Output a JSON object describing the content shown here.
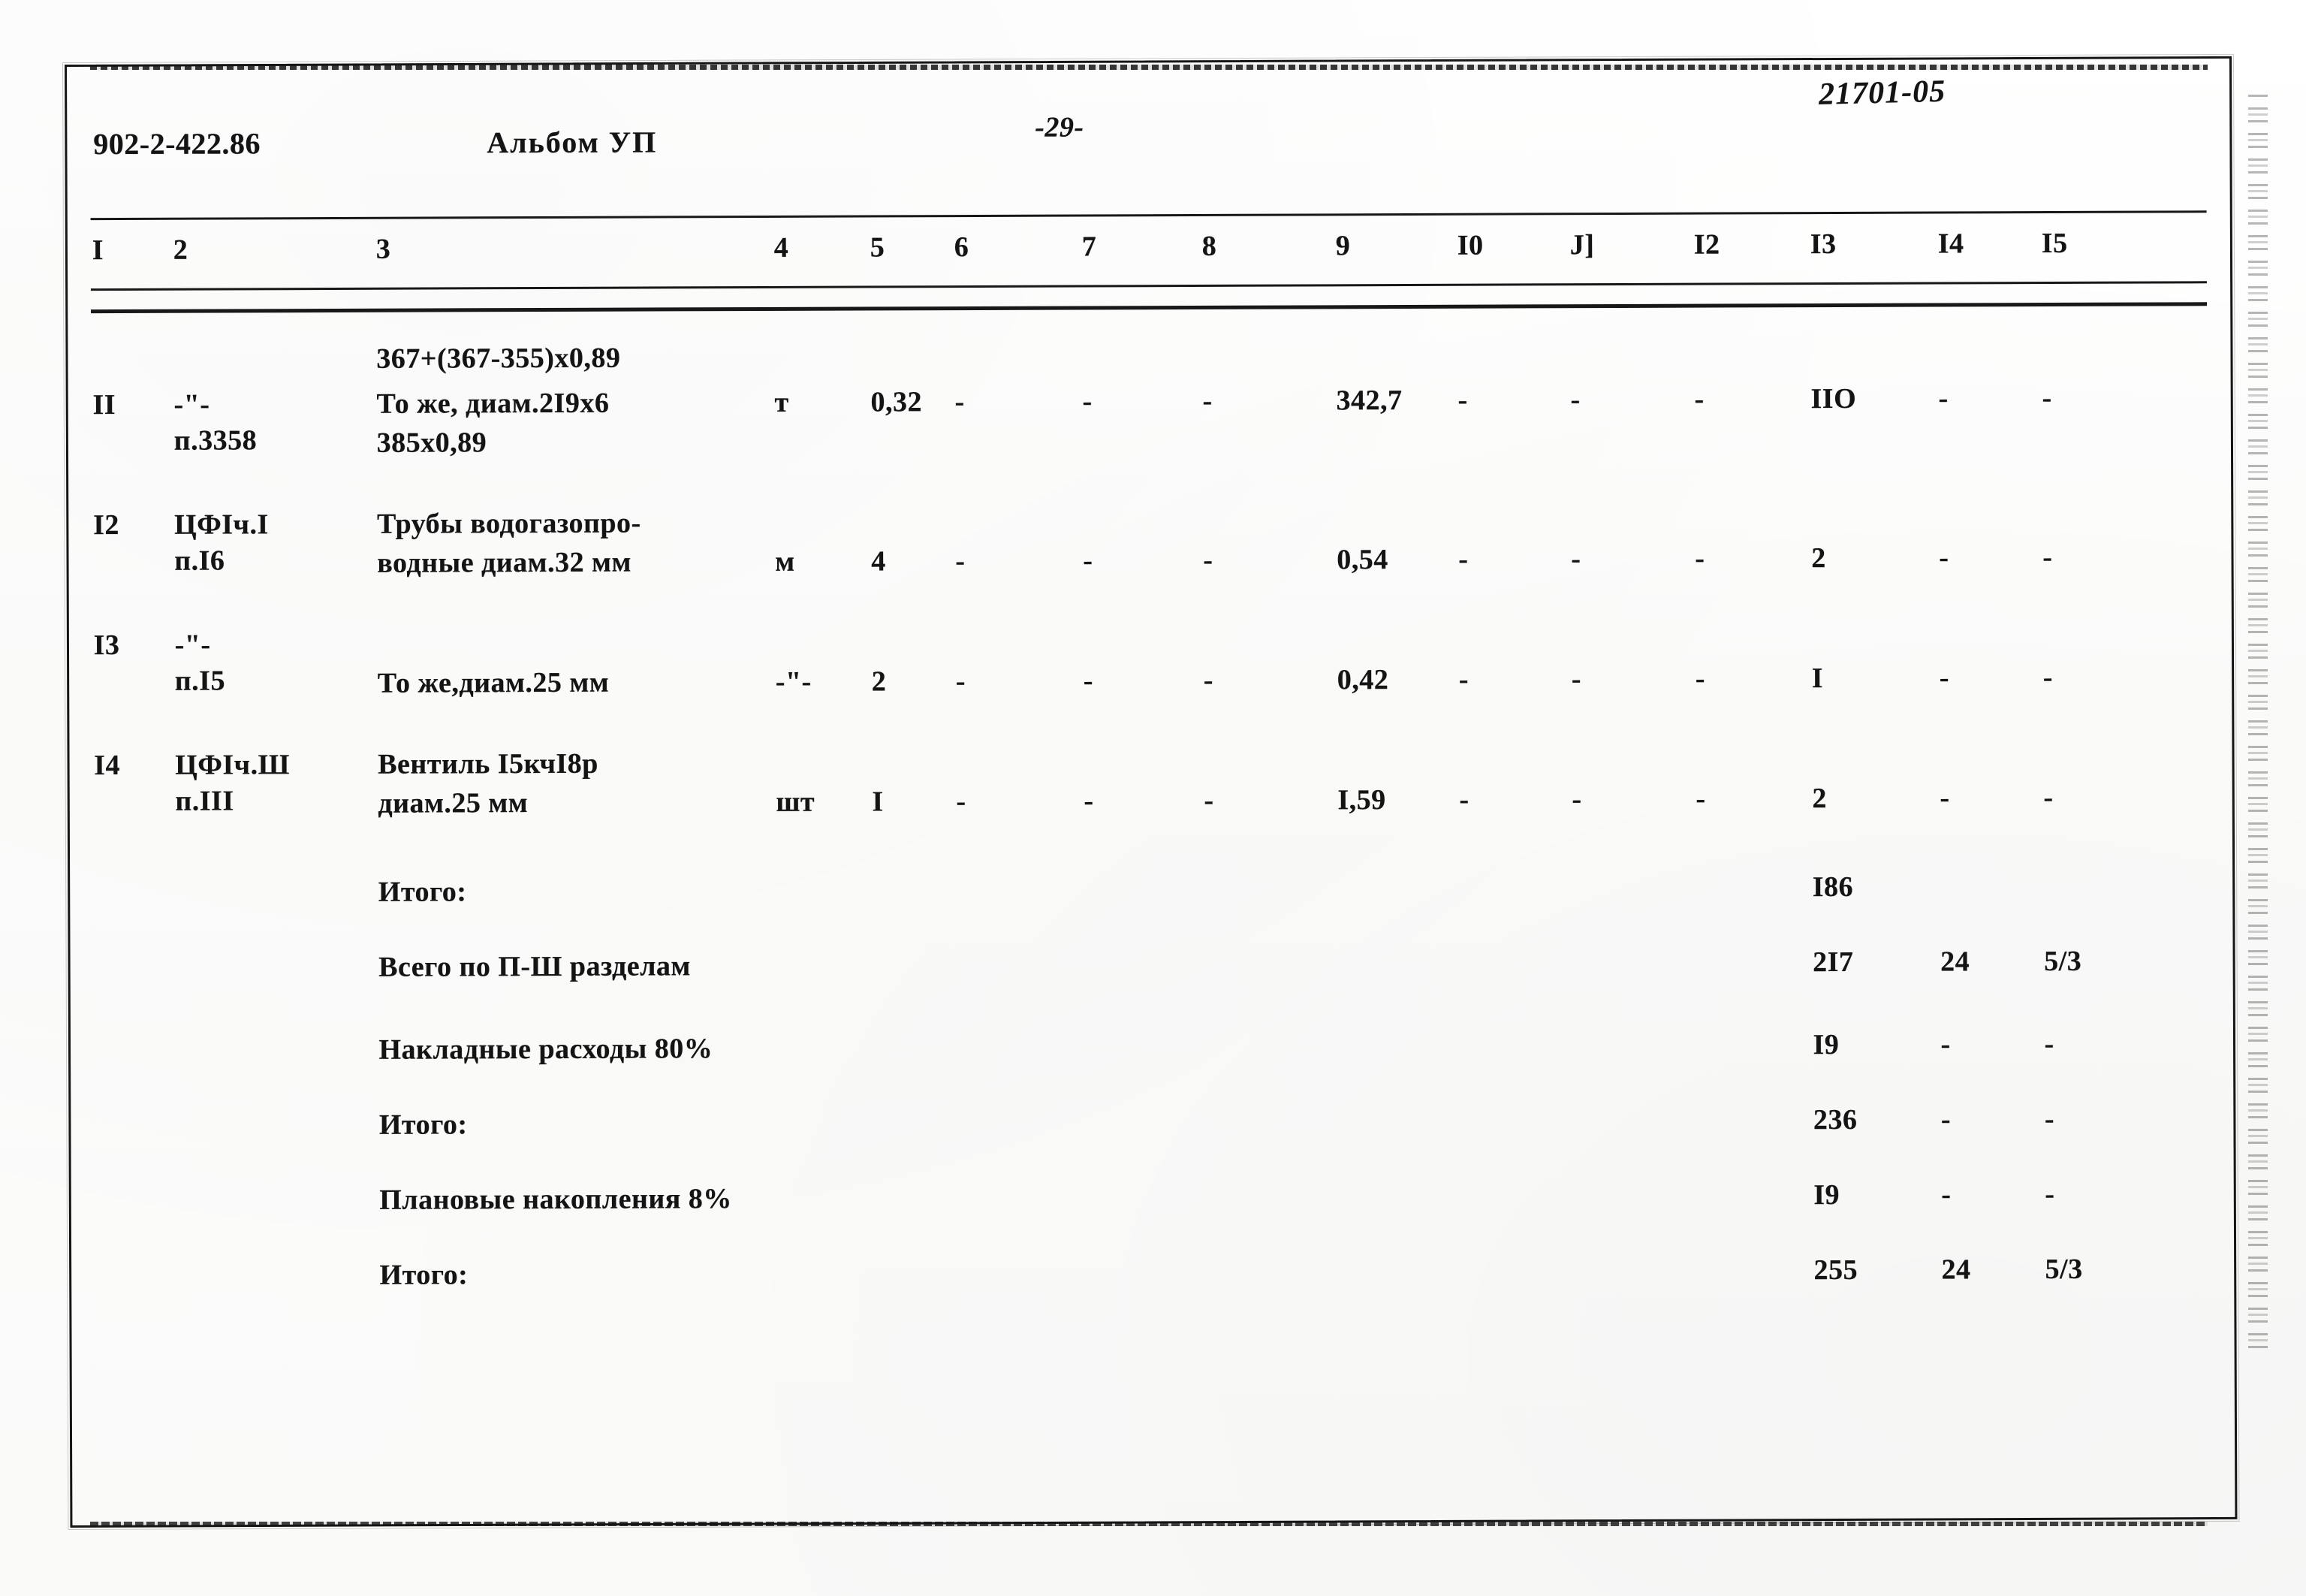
{
  "header": {
    "doc_code": "902-2-422.86",
    "album": "Альбом УП",
    "page_number": "-29-",
    "archive_stamp": "21701-05"
  },
  "table": {
    "column_headers": [
      "I",
      "2",
      "3",
      "4",
      "5",
      "6",
      "7",
      "8",
      "9",
      "I0",
      "J]",
      "I2",
      "I3",
      "I4",
      "I5"
    ],
    "carryover_formula": "367+(367-355)x0,89",
    "rows": [
      {
        "num": "II",
        "ref_line1": "-\"-",
        "ref_line2": "п.3358",
        "desc_line1": "То же, диам.2I9x6",
        "desc_line2": "385x0,89",
        "unit": "т",
        "c5": "0,32",
        "c6": "-",
        "c7": "-",
        "c8": "-",
        "c9": "342,7",
        "c10": "-",
        "c11": "-",
        "c12": "-",
        "c13": "IIO",
        "c14": "-",
        "c15": "-"
      },
      {
        "num": "I2",
        "ref_line1": "ЦФIч.I",
        "ref_line2": "п.I6",
        "desc_line1": "Трубы водогазопро-",
        "desc_line2": "водные диам.32 мм",
        "unit": "м",
        "c5": "4",
        "c6": "-",
        "c7": "-",
        "c8": "-",
        "c9": "0,54",
        "c10": "-",
        "c11": "-",
        "c12": "-",
        "c13": "2",
        "c14": "-",
        "c15": "-"
      },
      {
        "num": "I3",
        "ref_line1": "-\"-",
        "ref_line2": "п.I5",
        "desc_line1": "",
        "desc_line2": "То же,диам.25 мм",
        "unit": "-\"-",
        "c5": "2",
        "c6": "-",
        "c7": "-",
        "c8": "-",
        "c9": "0,42",
        "c10": "-",
        "c11": "-",
        "c12": "-",
        "c13": "I",
        "c14": "-",
        "c15": "-"
      },
      {
        "num": "I4",
        "ref_line1": "ЦФIч.Ш",
        "ref_line2": "п.III",
        "desc_line1": "Вентиль I5кчI8р",
        "desc_line2": "диам.25 мм",
        "unit": "шт",
        "c5": "I",
        "c6": "-",
        "c7": "-",
        "c8": "-",
        "c9": "I,59",
        "c10": "-",
        "c11": "-",
        "c12": "-",
        "c13": "2",
        "c14": "-",
        "c15": "-"
      }
    ],
    "summary_rows": [
      {
        "label": "Итого:",
        "c13": "I86",
        "c14": "",
        "c15": ""
      },
      {
        "label": "Всего по П-Ш разделам",
        "c13": "2I7",
        "c14": "24",
        "c15": "5/3"
      },
      {
        "label": "Накладные расходы 80%",
        "c13": "I9",
        "c14": "-",
        "c15": "-"
      },
      {
        "label": "Итого:",
        "c13": "236",
        "c14": "-",
        "c15": "-"
      },
      {
        "label": "Плановые накопления 8%",
        "c13": "I9",
        "c14": "-",
        "c15": "-"
      },
      {
        "label": "Итого:",
        "c13": "255",
        "c14": "24",
        "c15": "5/3"
      }
    ]
  },
  "layout": {
    "col_x": [
      122,
      230,
      500,
      1030,
      1158,
      1270,
      1440,
      1600,
      1778,
      1940,
      2090,
      2255,
      2410,
      2580,
      2718
    ],
    "row_y": [
      456,
      512,
      660,
      820,
      980
    ],
    "summary_y": [
      1162,
      1262,
      1372,
      1472,
      1572,
      1672
    ]
  }
}
